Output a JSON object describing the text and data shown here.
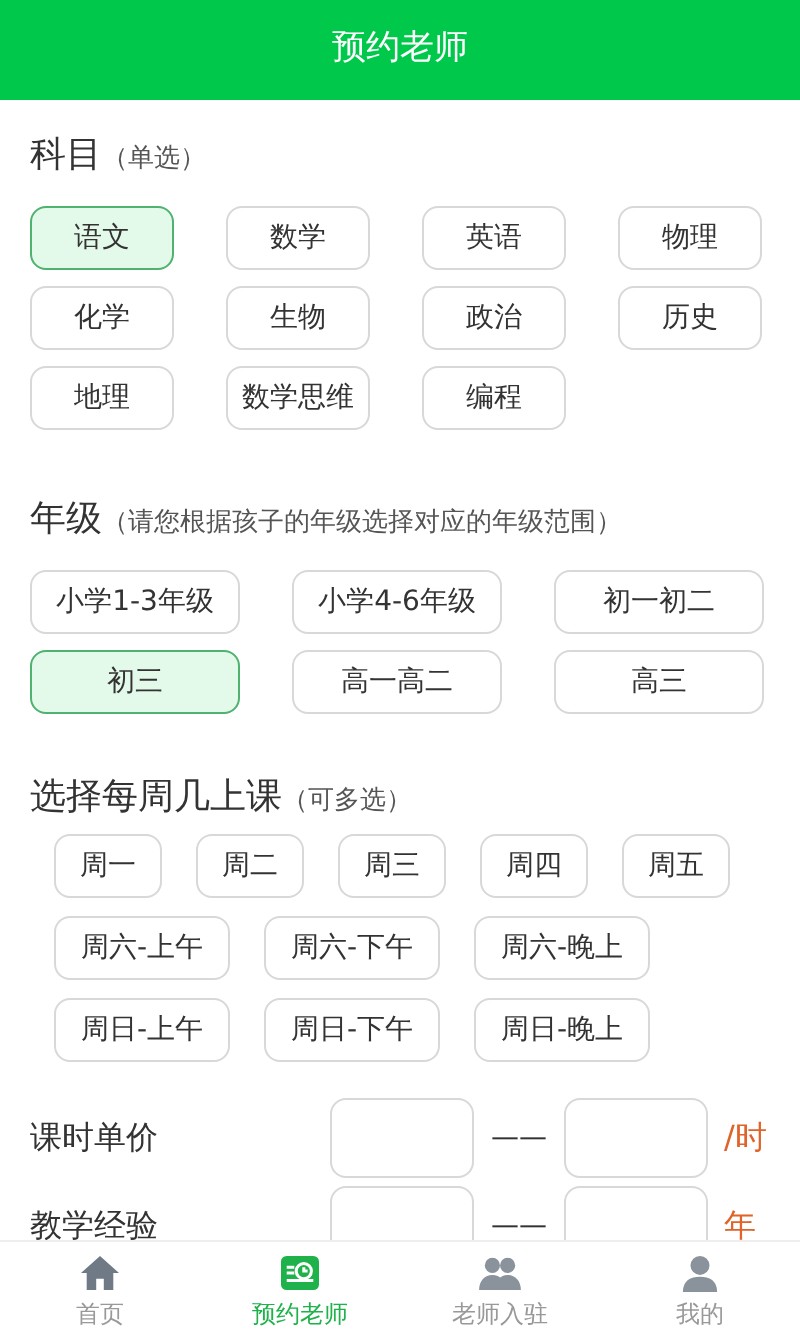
{
  "header": {
    "title": "预约老师"
  },
  "subject": {
    "title": "科目",
    "hint": "（单选）",
    "options": [
      {
        "label": "语文",
        "selected": true
      },
      {
        "label": "数学",
        "selected": false
      },
      {
        "label": "英语",
        "selected": false
      },
      {
        "label": "物理",
        "selected": false
      },
      {
        "label": "化学",
        "selected": false
      },
      {
        "label": "生物",
        "selected": false
      },
      {
        "label": "政治",
        "selected": false
      },
      {
        "label": "历史",
        "selected": false
      },
      {
        "label": "地理",
        "selected": false
      },
      {
        "label": "数学思维",
        "selected": false
      },
      {
        "label": "编程",
        "selected": false
      }
    ]
  },
  "grade": {
    "title": "年级",
    "hint": "（请您根据孩子的年级选择对应的年级范围）",
    "options": [
      {
        "label": "小学1-3年级",
        "selected": false
      },
      {
        "label": "小学4-6年级",
        "selected": false
      },
      {
        "label": "初一初二",
        "selected": false
      },
      {
        "label": "初三",
        "selected": true
      },
      {
        "label": "高一高二",
        "selected": false
      },
      {
        "label": "高三",
        "selected": false
      }
    ]
  },
  "weekdays": {
    "title": "选择每周几上课",
    "hint": "（可多选）",
    "options": [
      {
        "kind": "day",
        "label": "周一",
        "selected": false
      },
      {
        "kind": "day",
        "label": "周二",
        "selected": false
      },
      {
        "kind": "day",
        "label": "周三",
        "selected": false
      },
      {
        "kind": "day",
        "label": "周四",
        "selected": false
      },
      {
        "kind": "day",
        "label": "周五",
        "selected": false
      },
      {
        "kind": "slot",
        "label": "周六-上午",
        "selected": false
      },
      {
        "kind": "slot",
        "label": "周六-下午",
        "selected": false
      },
      {
        "kind": "slot",
        "label": "周六-晚上",
        "selected": false
      },
      {
        "kind": "slot",
        "label": "周日-上午",
        "selected": false
      },
      {
        "kind": "slot",
        "label": "周日-下午",
        "selected": false
      },
      {
        "kind": "slot",
        "label": "周日-晚上",
        "selected": false
      }
    ]
  },
  "ranges": [
    {
      "label": "课时单价",
      "separator": "——",
      "unit": "/时"
    },
    {
      "label": "教学经验",
      "separator": "——",
      "unit": "年"
    }
  ],
  "tab_bar": [
    {
      "label": "首页",
      "selected": false
    },
    {
      "label": "预约老师",
      "selected": true
    },
    {
      "label": "老师入驻",
      "selected": false
    },
    {
      "label": "我的",
      "selected": false
    }
  ]
}
